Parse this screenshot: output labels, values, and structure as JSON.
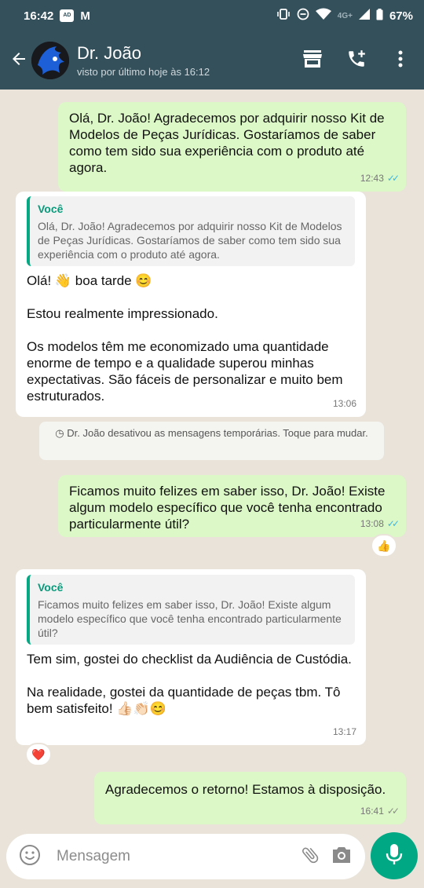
{
  "status_bar": {
    "time": "16:42",
    "network": "4G+",
    "battery": "67%"
  },
  "header": {
    "contact_name": "Dr. João",
    "contact_status": "visto por último hoje às 16:12"
  },
  "messages": [
    {
      "direction": "out",
      "text": "Olá, Dr. João! Agradecemos por adquirir nosso Kit de Modelos de Peças Jurídicas. Gostaríamos de saber como tem sido sua experiência com o produto até agora.",
      "time": "12:43",
      "status": "read"
    },
    {
      "direction": "in",
      "quote_author": "Você",
      "quote_text": "Olá, Dr. João! Agradecemos por adquirir nosso Kit de Modelos de Peças Jurídicas. Gostaríamos de saber como tem sido sua experiência com o produto até agora.",
      "text": "Olá! 👋 boa tarde 😊\n\nEstou realmente impressionado.\n\nOs modelos têm me economizado uma quantidade enorme de tempo e a qualidade superou minhas expectativas. São fáceis de personalizar e muito bem estruturados.",
      "time": "13:06"
    },
    {
      "direction": "system",
      "text": "Dr. João desativou as mensagens temporárias. Toque para mudar."
    },
    {
      "direction": "out",
      "text": "Ficamos muito felizes em saber isso, Dr. João! Existe algum modelo específico que você tenha encontrado particularmente útil?",
      "time": "13:08",
      "status": "read",
      "reaction": "👍"
    },
    {
      "direction": "in",
      "quote_author": "Você",
      "quote_text": "Ficamos muito felizes em saber isso, Dr. João! Existe algum modelo específico que você tenha encontrado particularmente útil?",
      "text": "Tem sim, gostei do checklist da Audiência de Custódia.\n\nNa realidade, gostei da quantidade de peças tbm. Tô bem satisfeito! 👍🏻👏🏻😊",
      "time": "13:17",
      "reaction": "❤️"
    },
    {
      "direction": "out",
      "text": "Agradecemos o retorno! Estamos à disposição.",
      "time": "16:41",
      "status": "delivered"
    }
  ],
  "input": {
    "placeholder": "Mensagem"
  },
  "colors": {
    "header_bg": "#34505b",
    "outgoing_bubble": "#dcf8c6",
    "incoming_bubble": "#ffffff",
    "accent": "#00a884",
    "read_tick": "#34b7f1"
  },
  "icons": [
    "back-arrow-icon",
    "avatar",
    "store-icon",
    "add-call-icon",
    "more-vert-icon",
    "emoji-icon",
    "attach-icon",
    "camera-icon",
    "mic-icon",
    "timer-icon"
  ]
}
